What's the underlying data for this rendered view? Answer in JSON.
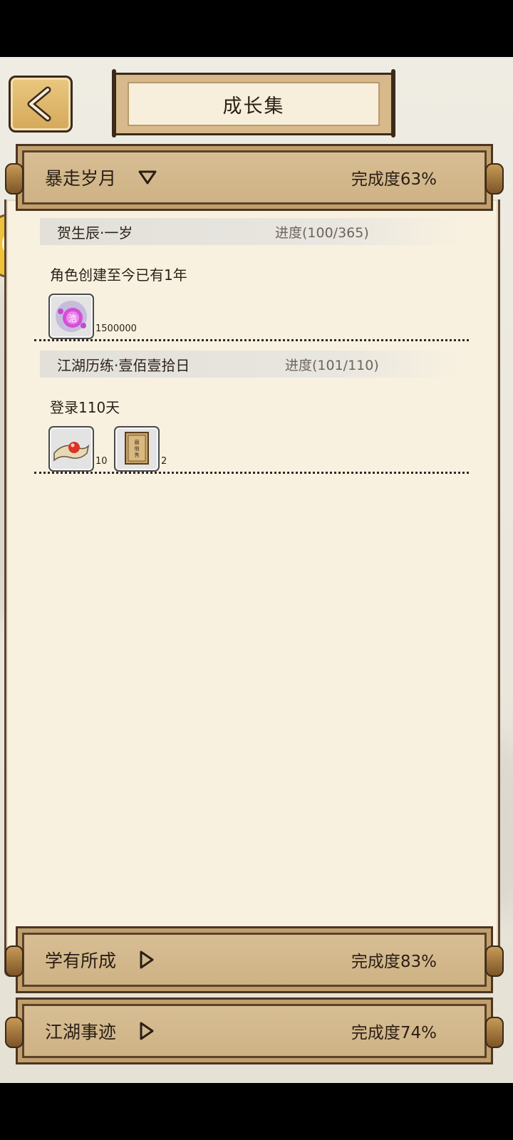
{
  "header": {
    "title": "成长集"
  },
  "categories": [
    {
      "name": "暴走岁月",
      "completion": "完成度63%",
      "expanded": true
    },
    {
      "name": "学有所成",
      "completion": "完成度83%",
      "expanded": false
    },
    {
      "name": "江湖事迹",
      "completion": "完成度74%",
      "expanded": false
    }
  ],
  "tasks": [
    {
      "title": "贺生辰·一岁",
      "progress": "进度(100/365)",
      "description": "角色创建至今已有1年",
      "rewards": [
        {
          "icon": "purple-orb-icon",
          "count": "1500000"
        }
      ]
    },
    {
      "title": "江湖历练·壹佰壹拾日",
      "progress": "进度(101/110)",
      "description": "登录110天",
      "rewards": [
        {
          "icon": "red-pearl-scroll-icon",
          "count": "10"
        },
        {
          "icon": "book-icon",
          "count": "2"
        }
      ]
    }
  ],
  "colors": {
    "panel": "#f8f1e0",
    "bar": "#d9bf96",
    "accent_gold": "#d5a85a"
  }
}
